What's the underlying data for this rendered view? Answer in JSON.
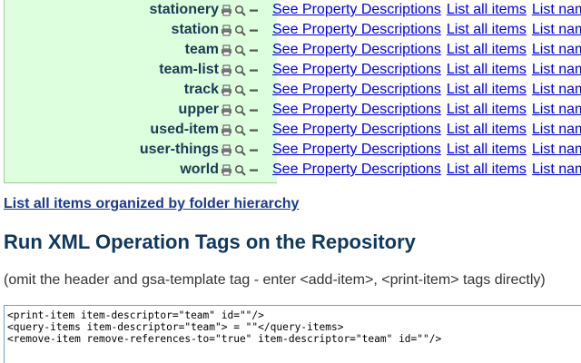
{
  "items": [
    {
      "name": "stationery"
    },
    {
      "name": "station"
    },
    {
      "name": "team"
    },
    {
      "name": "team-list"
    },
    {
      "name": "track"
    },
    {
      "name": "upper"
    },
    {
      "name": "used-item"
    },
    {
      "name": "user-things"
    },
    {
      "name": "world"
    }
  ],
  "row_links": {
    "property_descriptions": "See Property Descriptions",
    "list_all_items": "List all items",
    "list_names": "List nam"
  },
  "icons": [
    "print-icon",
    "search-icon",
    "minus-icon"
  ],
  "colors": {
    "table_bg": "#ddffdd",
    "item_name": "#1b3b54",
    "link": "#0000ee",
    "heading": "#10375c"
  },
  "folder_link": "List all items organized by folder hierarchy",
  "heading": "Run XML Operation Tags on the Repository",
  "hint": "(omit the header and gsa-template tag - enter <add-item>, <print-item> tags directly)",
  "editor": {
    "lines": [
      "<print-item item-descriptor=\"team\" id=\"\"/>",
      "<query-items item-descriptor=\"team\"> = \"\"</query-items>",
      "<remove-item remove-references-to=\"true\" item-descriptor=\"team\" id=\"\"/>"
    ]
  }
}
